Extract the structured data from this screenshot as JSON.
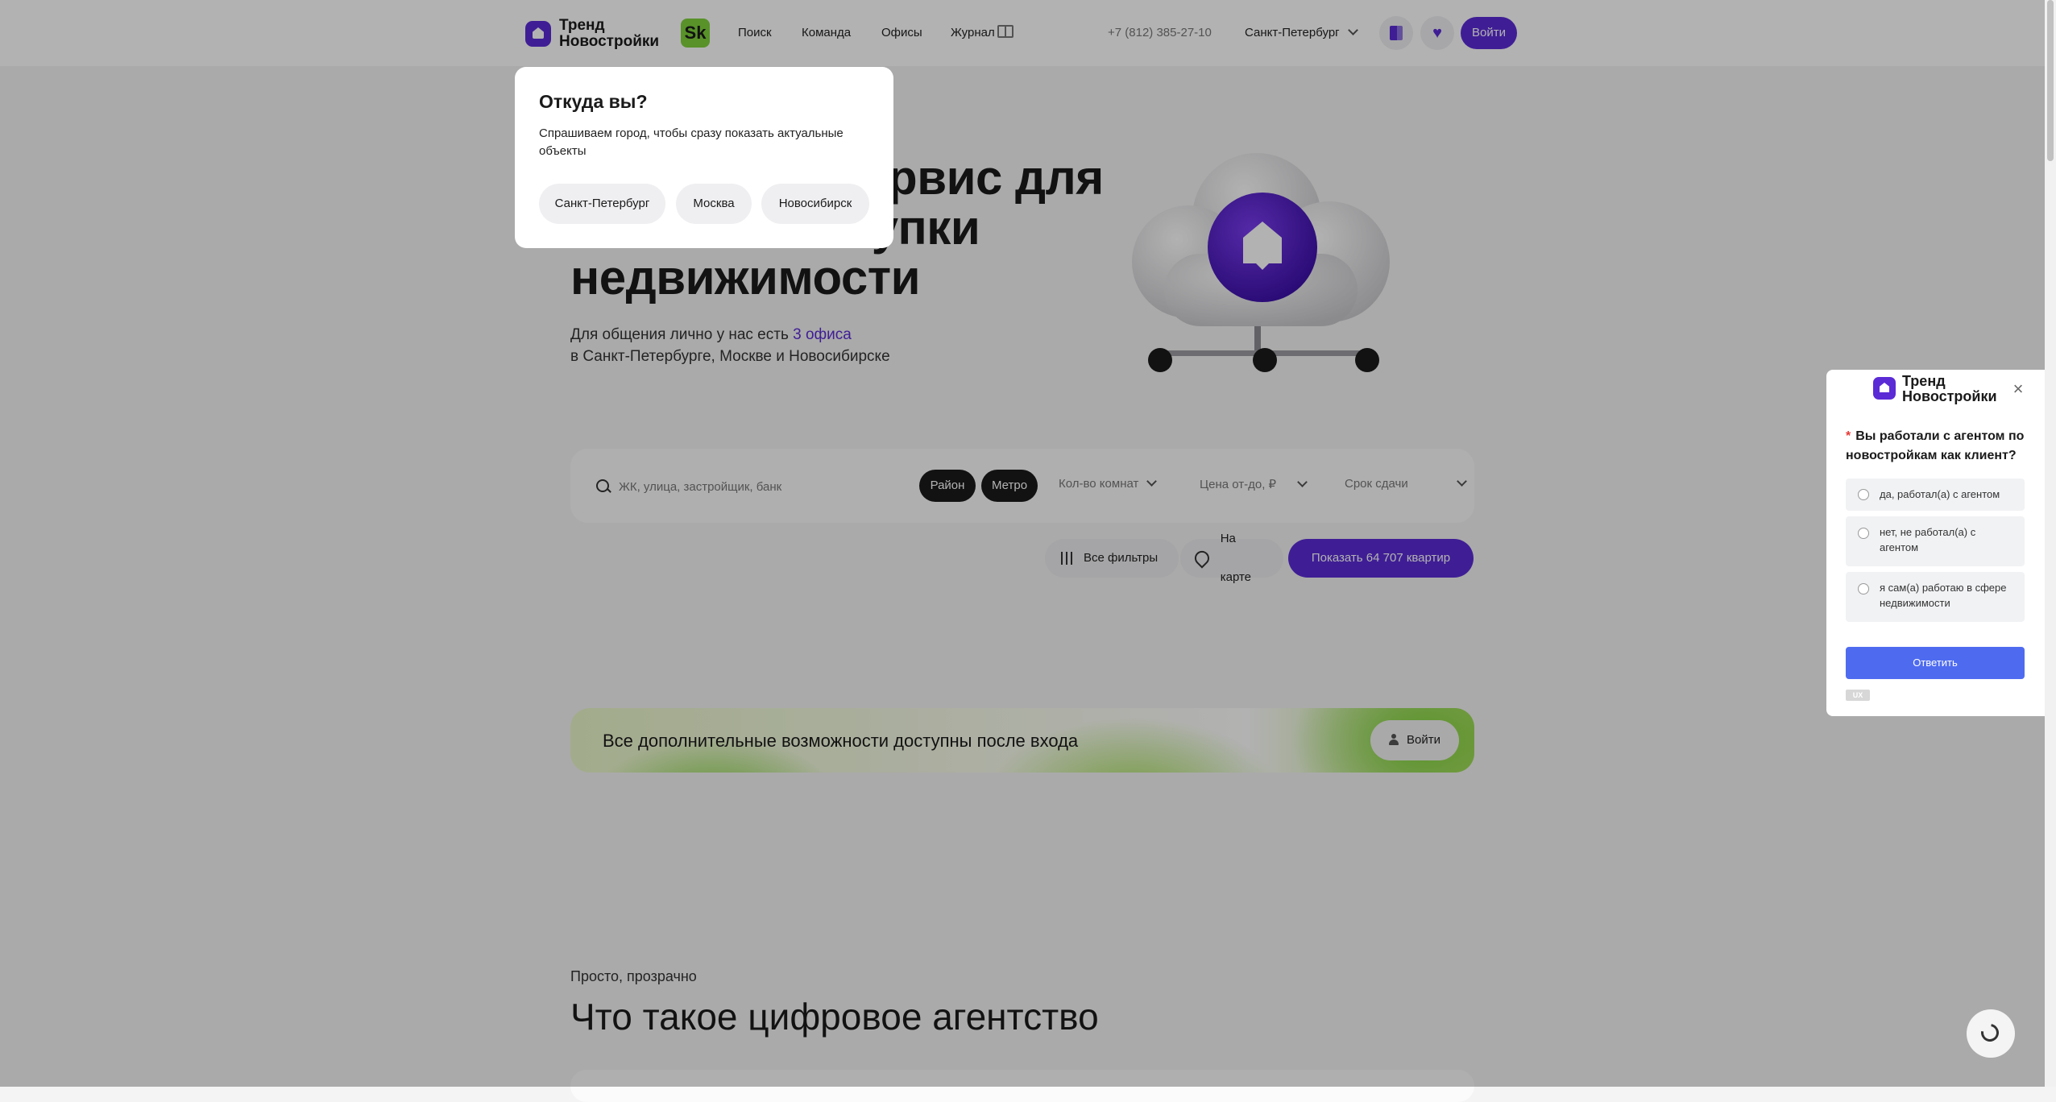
{
  "header": {
    "logo_text": "Тренд Новостройки",
    "sk_badge": "Sk",
    "nav": [
      "Поиск",
      "Команда",
      "Офисы",
      "Журнал"
    ],
    "phone": "+7 (812) 385-27-10",
    "city": "Санкт-Петербург",
    "login_label": "Войти"
  },
  "hero": {
    "title": "Цифровой сервис для поиска и покупки недвижимости",
    "sub_prefix": "Для общения лично у нас есть ",
    "sub_link": "3 офиса",
    "sub_suffix": "в Санкт-Петербурге, Москве и Новосибирске"
  },
  "search": {
    "placeholder": "ЖК, улица, застройщик, банк",
    "district_label": "Район",
    "metro_label": "Метро",
    "rooms_label": "Кол-во комнат",
    "price_label": "Цена от-до, ₽",
    "deadline_label": "Срок сдачи",
    "all_filters_label": "Все фильтры",
    "map_label": "На карте",
    "show_label": "Показать 64 707 квартир"
  },
  "banner": {
    "text": "Все дополнительные возможности доступны после входа",
    "login_label": "Войти"
  },
  "section": {
    "eyebrow": "Просто, прозрачно",
    "title": "Что такое цифровое агентство"
  },
  "city_popup": {
    "title": "Откуда вы?",
    "text": "Спрашиваем город, чтобы сразу показать актуальные объекты",
    "cities": [
      "Санкт-Петербург",
      "Москва",
      "Новосибирск"
    ]
  },
  "survey": {
    "logo_text": "Тренд Новостройки",
    "question": "Вы работали с агентом по новостройкам как клиент?",
    "options": [
      "да, работал(а) с агентом",
      "нет, не работал(а) с агентом",
      "я сам(а) работаю в сфере недвижимости"
    ],
    "submit_label": "Ответить",
    "brand_label": "UX"
  },
  "colors": {
    "accent": "#5b2bd6",
    "sk_green": "#7fd13b",
    "survey_button": "#4e6bf0"
  },
  "icons": [
    "search-icon",
    "journal-icon",
    "compare-icon",
    "heart-icon",
    "filter-icon",
    "map-pin-icon",
    "user-icon",
    "close-icon",
    "chat-icon",
    "chevron-down-icon"
  ]
}
